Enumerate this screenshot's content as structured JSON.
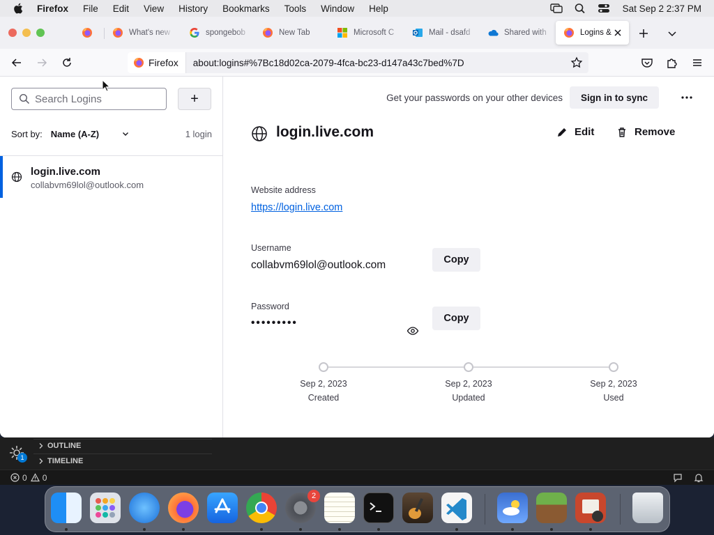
{
  "menubar": {
    "items": [
      "Firefox",
      "File",
      "Edit",
      "View",
      "History",
      "Bookmarks",
      "Tools",
      "Window",
      "Help"
    ],
    "clock": "Sat Sep 2  2:37 PM"
  },
  "tabs": [
    {
      "label": ""
    },
    {
      "label": "What's new"
    },
    {
      "label": "spongebob"
    },
    {
      "label": "New Tab"
    },
    {
      "label": "Microsoft C"
    },
    {
      "label": "Mail - dsafd"
    },
    {
      "label": "Shared with"
    },
    {
      "label": "Logins &"
    }
  ],
  "navbar": {
    "identity_label": "Firefox",
    "url": "about:logins#%7Bc18d02ca-2079-4fca-bc23-d147a43c7bed%7D"
  },
  "sidebar": {
    "search_placeholder": "Search Logins",
    "add_label": "+",
    "sort_label": "Sort by:",
    "sort_value": "Name (A-Z)",
    "count": "1 login",
    "items": [
      {
        "title": "login.live.com",
        "username": "collabvm69lol@outlook.com"
      }
    ]
  },
  "main": {
    "sync_text": "Get your passwords on your other devices",
    "sync_button": "Sign in to sync",
    "site_title": "login.live.com",
    "edit_label": "Edit",
    "remove_label": "Remove",
    "website_label": "Website address",
    "website_value": "https://login.live.com",
    "username_label": "Username",
    "username_value": "collabvm69lol@outlook.com",
    "password_label": "Password",
    "password_value": "•••••••••",
    "copy_label": "Copy",
    "timeline": [
      {
        "date": "Sep 2, 2023",
        "label": "Created"
      },
      {
        "date": "Sep 2, 2023",
        "label": "Updated"
      },
      {
        "date": "Sep 2, 2023",
        "label": "Used"
      }
    ]
  },
  "vscode": {
    "outline_label": "OUTLINE",
    "timeline_label": "TIMELINE",
    "badge": "1",
    "errors": "0",
    "warnings": "0"
  },
  "dock": {
    "settings_badge": "2"
  },
  "colors": {
    "accent": "#0061e0",
    "link": "#0061e0"
  }
}
